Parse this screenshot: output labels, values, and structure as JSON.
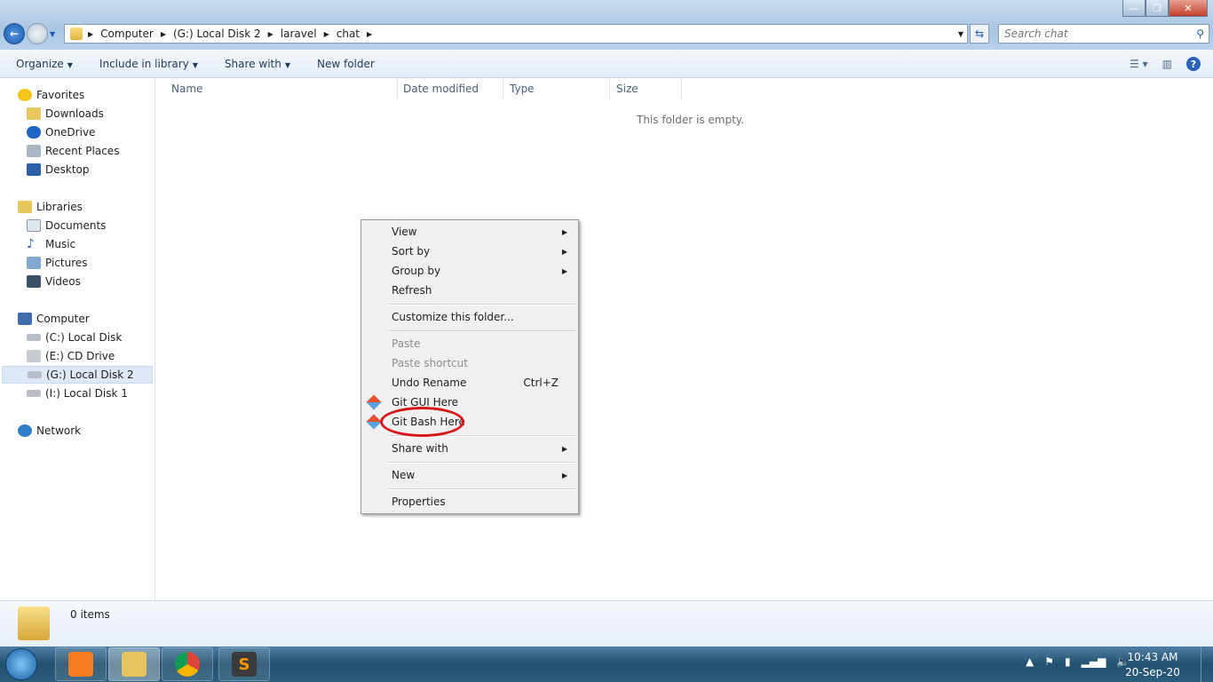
{
  "window": {
    "minimize": "—",
    "maximize": "❐",
    "close": "✕"
  },
  "address": {
    "crumbs": [
      "Computer",
      "(G:) Local Disk 2",
      "laravel",
      "chat"
    ]
  },
  "search": {
    "placeholder": "Search chat"
  },
  "toolbar": {
    "organize": "Organize",
    "include": "Include in library",
    "share": "Share with",
    "new_folder": "New folder"
  },
  "sidebar": {
    "favorites": "Favorites",
    "downloads": "Downloads",
    "onedrive": "OneDrive",
    "recent": "Recent Places",
    "desktop": "Desktop",
    "libraries": "Libraries",
    "documents": "Documents",
    "music": "Music",
    "pictures": "Pictures",
    "videos": "Videos",
    "computer": "Computer",
    "c": "(C:) Local Disk",
    "e": "(E:) CD Drive",
    "g": "(G:) Local Disk 2",
    "i": "(I:) Local Disk 1",
    "network": "Network"
  },
  "columns": [
    "Name",
    "Date modified",
    "Type",
    "Size"
  ],
  "empty_message": "This folder is empty.",
  "context_menu": {
    "view": "View",
    "sort": "Sort by",
    "group": "Group by",
    "refresh": "Refresh",
    "customize": "Customize this folder...",
    "paste": "Paste",
    "paste_shortcut": "Paste shortcut",
    "undo": "Undo Rename",
    "undo_shortcut": "Ctrl+Z",
    "git_gui": "Git GUI Here",
    "git_bash": "Git Bash Here",
    "share": "Share with",
    "new": "New",
    "properties": "Properties"
  },
  "highlight_color": "#d8141b",
  "status": {
    "items": "0 items"
  },
  "taskbar": {
    "time": "10:43 AM",
    "date": "20-Sep-20",
    "apps": [
      "XAMPP",
      "Windows Explorer",
      "Google Chrome",
      "Sublime Text"
    ]
  }
}
